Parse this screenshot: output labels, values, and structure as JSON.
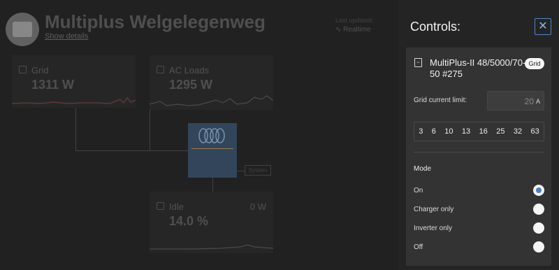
{
  "dashboard": {
    "title": "Multiplus Welgelegenweg",
    "show_details": "Show details",
    "last_updated_label": "Last updated:",
    "realtime_label": "Realtime",
    "grid": {
      "label": "Grid",
      "value": "1311 W"
    },
    "ac_loads": {
      "label": "AC Loads",
      "value": "1295 W"
    },
    "system_tag": "System",
    "inverter_state": {
      "label": "Idle",
      "value": "14.0 %",
      "power": "0 W"
    }
  },
  "controls": {
    "title": "Controls:",
    "close_icon": "close-icon",
    "device": {
      "icon": "inverter-icon",
      "name": "MultiPlus-II 48/5000/70-50 #275",
      "badge": "Grid"
    },
    "current_limit": {
      "label": "Grid current limit:",
      "value": "20",
      "unit": "A",
      "presets": [
        "3",
        "6",
        "10",
        "13",
        "16",
        "25",
        "32",
        "63"
      ]
    },
    "mode": {
      "title": "Mode",
      "selected": "On",
      "options": [
        "On",
        "Charger only",
        "Inverter only",
        "Off"
      ]
    }
  },
  "colors": {
    "accent": "#4a7fc0",
    "inverter_block": "#3a4f68",
    "panel_bg": "#242424",
    "card_bg": "#333333"
  }
}
